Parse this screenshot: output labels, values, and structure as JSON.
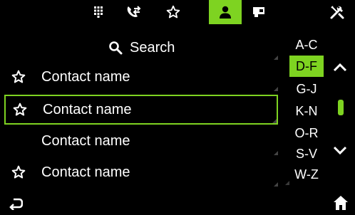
{
  "colors": {
    "accent": "#7ed321",
    "background": "#000000",
    "text": "#ffffff"
  },
  "top_tabs": [
    {
      "icon": "dialpad-icon",
      "active": false
    },
    {
      "icon": "recent-calls-icon",
      "active": false
    },
    {
      "icon": "favorites-star-icon",
      "active": false
    },
    {
      "icon": "contacts-person-icon",
      "active": true
    },
    {
      "icon": "messages-icon",
      "active": false
    }
  ],
  "search": {
    "label": "Search"
  },
  "contacts": [
    {
      "name": "Contact name",
      "favorite": true,
      "selected": false
    },
    {
      "name": "Contact name",
      "favorite": true,
      "selected": true
    },
    {
      "name": "Contact name",
      "favorite": false,
      "selected": false
    },
    {
      "name": "Contact name",
      "favorite": true,
      "selected": false
    }
  ],
  "alphabet_index": [
    {
      "label": "A-C",
      "active": false
    },
    {
      "label": "D-F",
      "active": true
    },
    {
      "label": "G-J",
      "active": false
    },
    {
      "label": "K-N",
      "active": false
    },
    {
      "label": "O-R",
      "active": false
    },
    {
      "label": "S-V",
      "active": false
    },
    {
      "label": "W-Z",
      "active": false
    }
  ],
  "controls": {
    "settings_icon": "settings-tools-icon",
    "scroll_up_icon": "chevron-up-icon",
    "scroll_down_icon": "chevron-down-icon",
    "back_icon": "back-icon",
    "home_icon": "home-icon"
  }
}
